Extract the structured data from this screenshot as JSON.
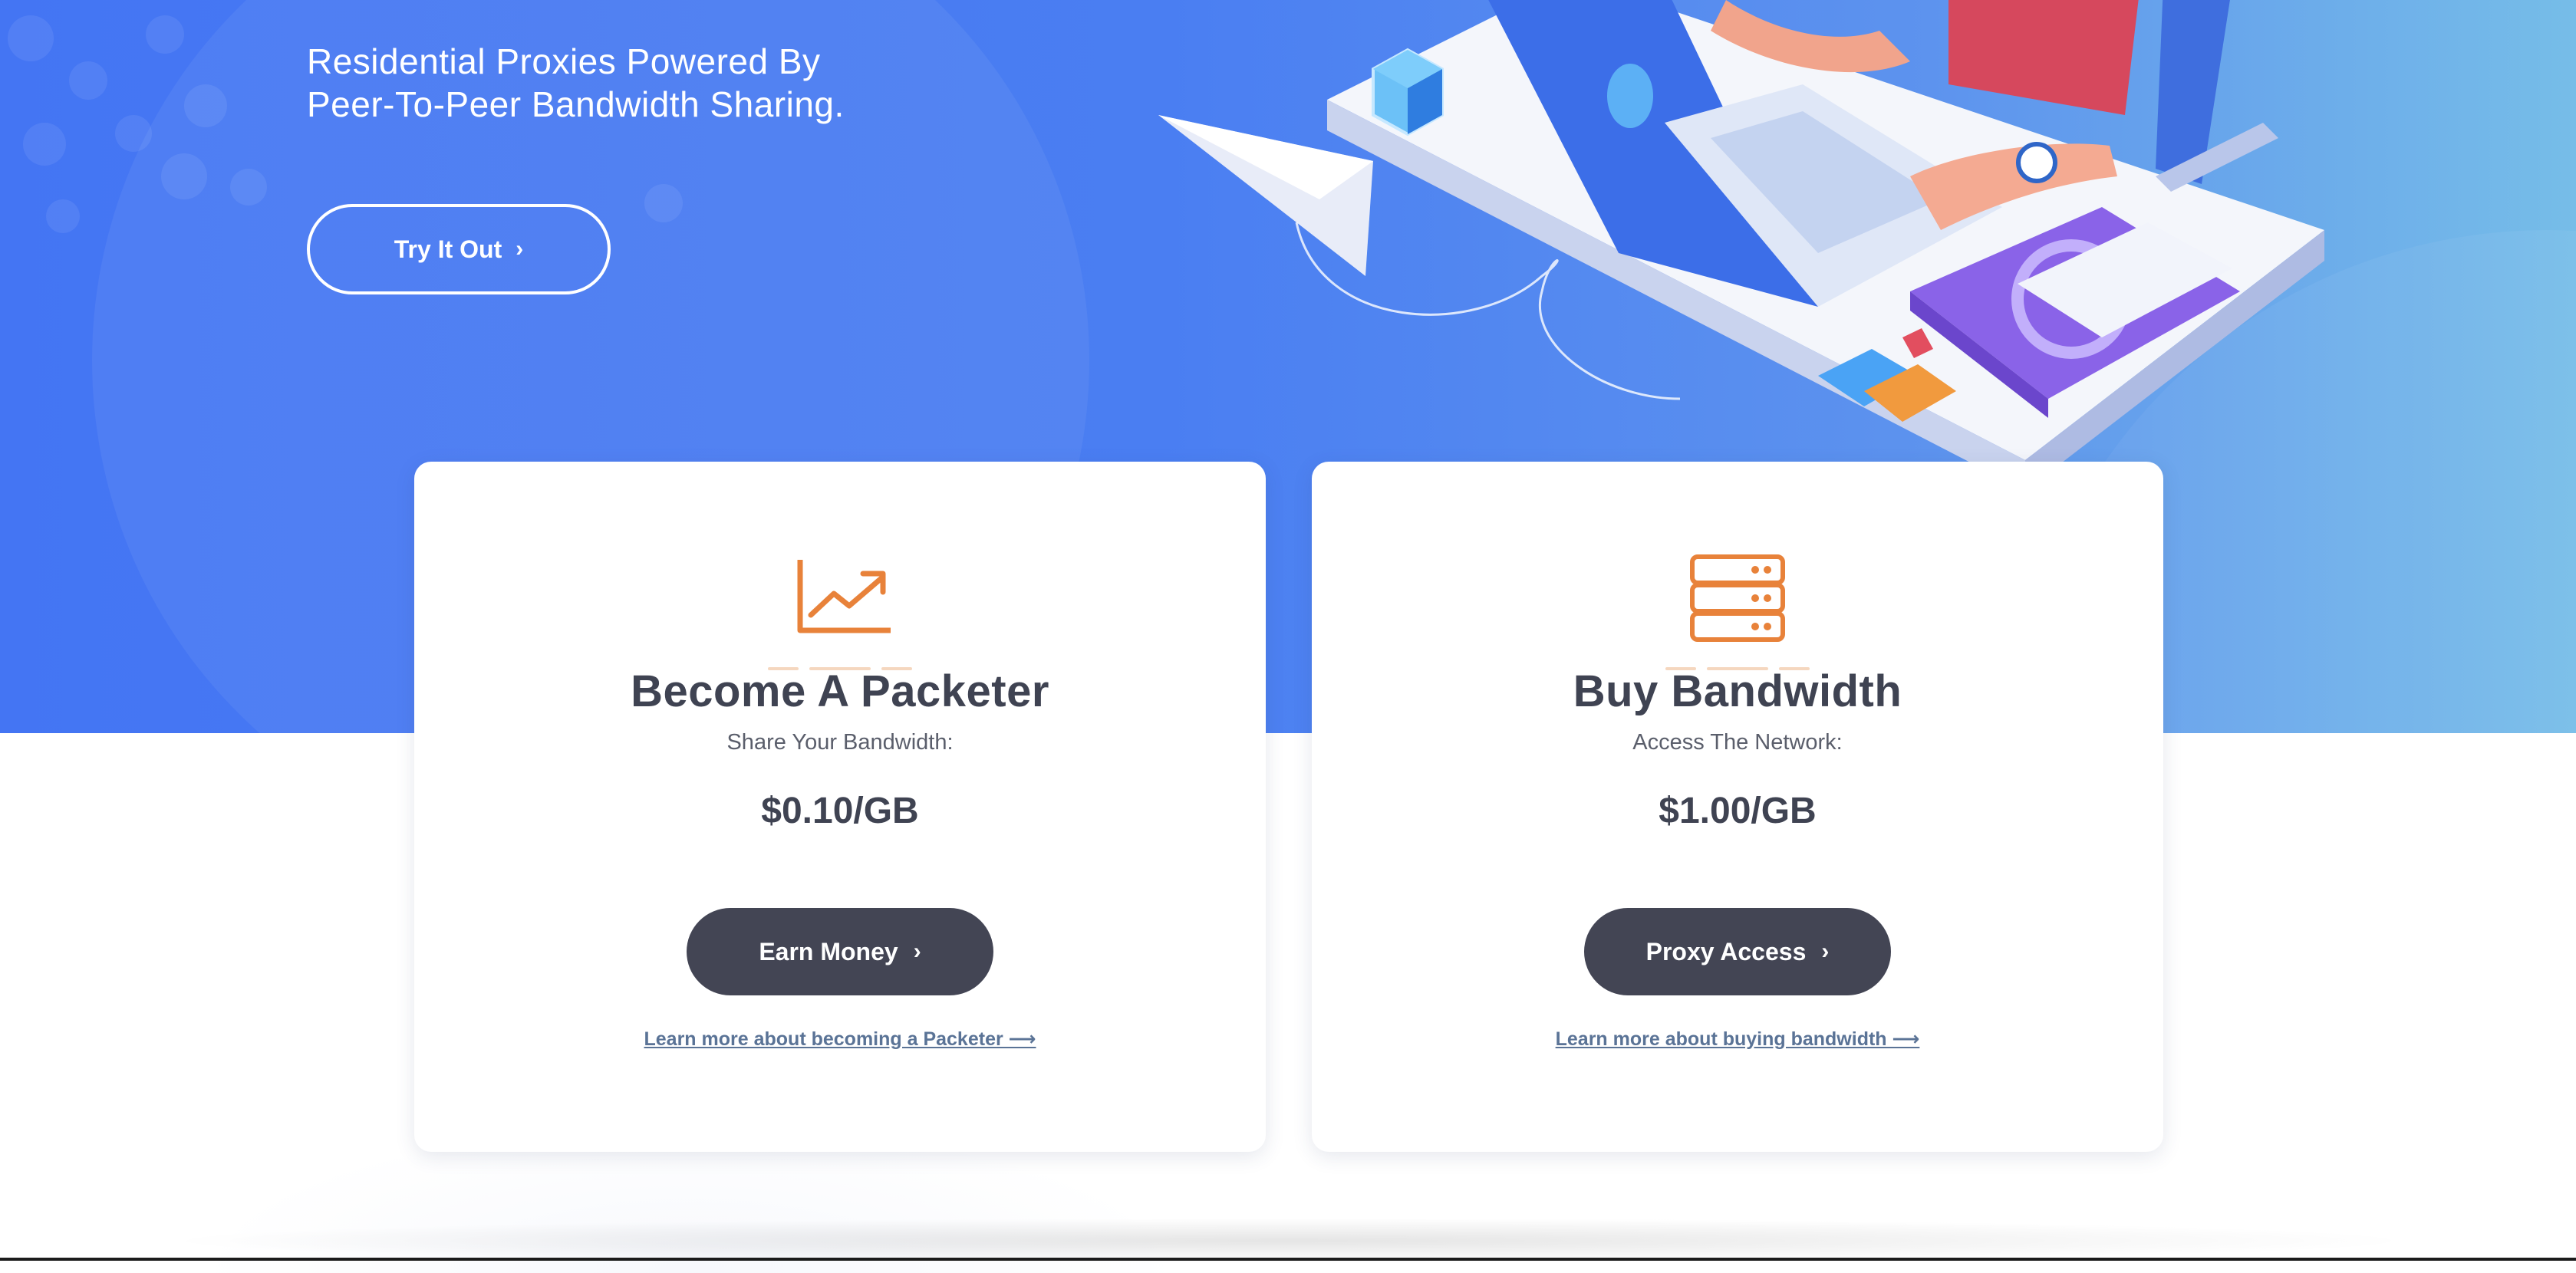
{
  "hero": {
    "headline_line1": "Residential Proxies Powered By",
    "headline_line2": "Peer-To-Peer Bandwidth Sharing.",
    "cta_label": "Try It Out",
    "cta_icon": "chevron-right-icon"
  },
  "cards": [
    {
      "icon": "trending-chart-icon",
      "title": "Become A Packeter",
      "subtitle": "Share Your Bandwidth:",
      "price": "$0.10/GB",
      "button_label": "Earn Money",
      "button_icon": "chevron-right-icon",
      "link_text": "Learn more about becoming a Packeter ⟶"
    },
    {
      "icon": "server-stack-icon",
      "title": "Buy Bandwidth",
      "subtitle": "Access The Network:",
      "price": "$1.00/GB",
      "button_label": "Proxy Access",
      "button_icon": "chevron-right-icon",
      "link_text": "Learn more about buying bandwidth ⟶"
    }
  ],
  "colors": {
    "hero_start": "#4475f3",
    "hero_end": "#76bde8",
    "accent_orange": "#e8823a",
    "button_dark": "#434554",
    "link": "#5a7396",
    "title": "#3f4352"
  }
}
